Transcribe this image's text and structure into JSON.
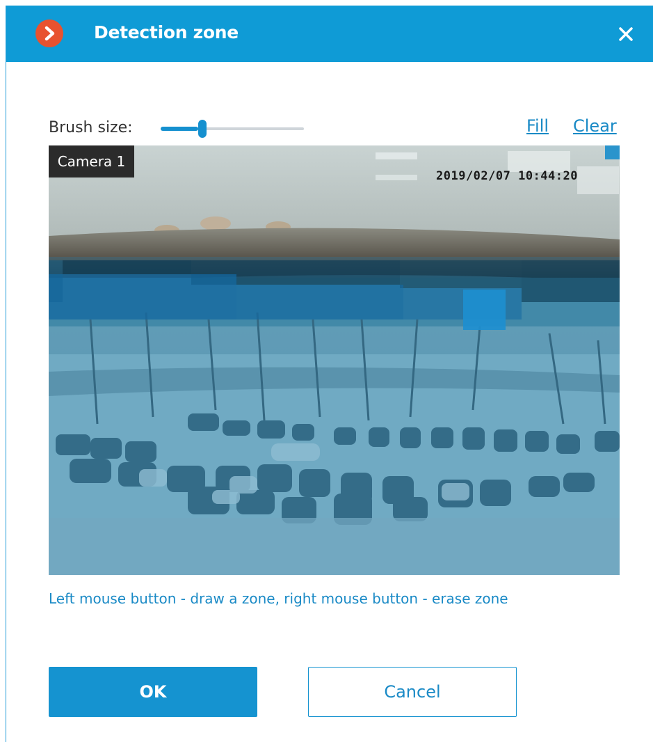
{
  "dialog": {
    "title": "Detection zone",
    "icon": "chevron-right-icon",
    "close_icon": "close-icon",
    "accent_color": "#0f9bd6"
  },
  "toolbar": {
    "brush_label": "Brush size:",
    "brush_size_fraction": 0.29,
    "fill_label": "Fill",
    "clear_label": "Clear"
  },
  "camera": {
    "label": "Camera 1",
    "timestamp": "2019/02/07 10:44:20"
  },
  "hint": "Left mouse button - draw a zone, right mouse button - erase zone",
  "buttons": {
    "ok": "OK",
    "cancel": "Cancel"
  }
}
